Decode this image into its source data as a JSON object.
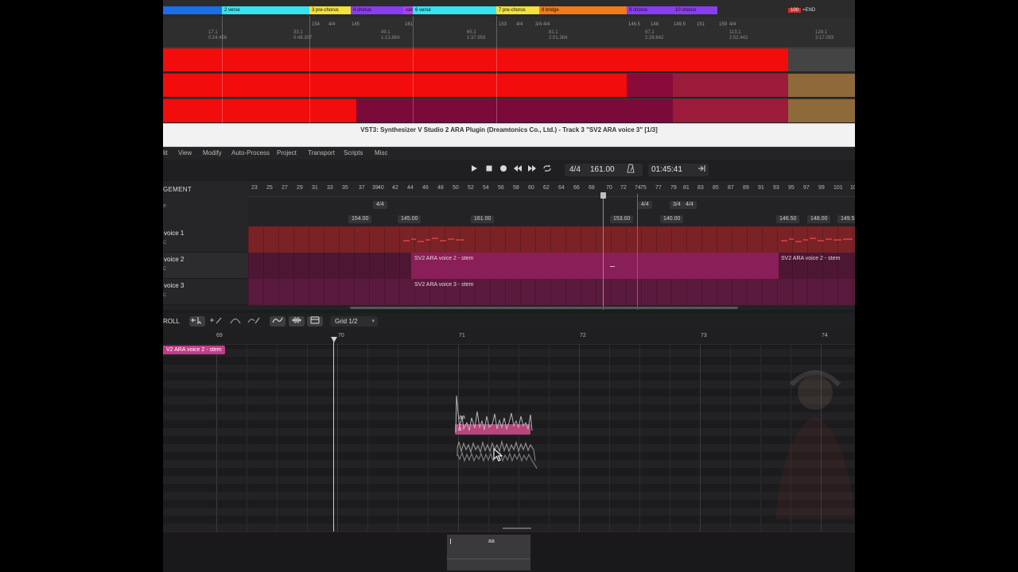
{
  "daw": {
    "markers": [
      {
        "label": "2 verse",
        "color": "#35e3f0"
      },
      {
        "label": "3 pre-chorus",
        "color": "#f4e13a"
      },
      {
        "label": "4 chorus",
        "color": "#8a3cf0"
      },
      {
        "label": "vam",
        "color": "#b43cf0"
      },
      {
        "label": "6 verse",
        "color": "#35e3f0"
      },
      {
        "label": "7 pre-chorus",
        "color": "#f4e13a"
      },
      {
        "label": "8 bridge",
        "color": "#f27a1a"
      },
      {
        "label": "9 chorus",
        "color": "#8a3cf0"
      },
      {
        "label": "10 chorus",
        "color": "#8a3cf0"
      }
    ],
    "end_marker": {
      "flag": "100",
      "label": "=END"
    },
    "ruler_ticks": [
      {
        "pos": "17.1",
        "time": "0:24.456"
      },
      {
        "pos": "33.1",
        "time": "0:48.307"
      },
      {
        "pos": "49.1",
        "time": "1:13.864"
      },
      {
        "pos": "65.1",
        "time": "1:37.959"
      },
      {
        "pos": "81.1",
        "time": "2:01.384"
      },
      {
        "pos": "97.1",
        "time": "2:28.642"
      },
      {
        "pos": "113.1",
        "time": "2:52.442"
      },
      {
        "pos": "129.1",
        "time": "3:17.093"
      }
    ],
    "ruler_ts": [
      "154",
      "4/4",
      "145",
      "161",
      "153",
      "4/4",
      "3/4",
      "4/4",
      "146.5",
      "148",
      "149.5",
      "151",
      "159",
      "4/4"
    ]
  },
  "plugin_title": "VST3: Synthesizer V Studio 2 ARA Plugin (Dreamtonics Co., Ltd.) - Track 3 \"SV2 ARA voice 3\" [1/3]",
  "menu": [
    "lit",
    "View",
    "Modify",
    "Auto-Process",
    "Project",
    "Transport",
    "Scripts",
    "Misc"
  ],
  "transport": {
    "time_signature": "4/4",
    "tempo": "161.00",
    "time": "01:45:41"
  },
  "arrangement": {
    "title": "GEMENT",
    "bars": [
      "23",
      "25",
      "27",
      "29",
      "31",
      "33",
      "35",
      "37",
      "39",
      "40",
      "42",
      "44",
      "46",
      "48",
      "50",
      "52",
      "54",
      "56",
      "58",
      "60",
      "62",
      "64",
      "66",
      "68",
      "70",
      "72",
      "74",
      "75",
      "77",
      "79",
      "81",
      "83",
      "85",
      "87",
      "89",
      "91",
      "93",
      "95",
      "97",
      "99",
      "101",
      "10"
    ],
    "ts_chips": [
      {
        "label": "4/4"
      },
      {
        "label": "4/4"
      },
      {
        "label": "3/4"
      },
      {
        "label": "4/4"
      }
    ],
    "tempo_chips": [
      "154.00",
      "145.00",
      "161.00",
      "153.00",
      "140.00",
      "146.50",
      "148.00",
      "149.5"
    ],
    "header_rows": [
      "e",
      ""
    ],
    "tracks": [
      {
        "name": "voice 1",
        "sub": "C"
      },
      {
        "name": "voice 2",
        "sub": "C",
        "clip_label": "SV2 ARA voice 2 - stem",
        "clip_label_2": "SV2 ARA voice 2 - stem"
      },
      {
        "name": "voice 3",
        "sub": "C",
        "clip_label": "SV2 ARA voice 3 - stem"
      }
    ]
  },
  "pianoroll": {
    "title": "ROLL",
    "grid": "Grid 1/2",
    "bars": [
      "69",
      "70",
      "71",
      "72",
      "73",
      "74"
    ],
    "stem_chip": "V2 ARA voice 2 - stem",
    "note_lyric": "a",
    "note_phoneme": "aa",
    "lower_lyric": "aa",
    "note_color": "#b9457d"
  }
}
